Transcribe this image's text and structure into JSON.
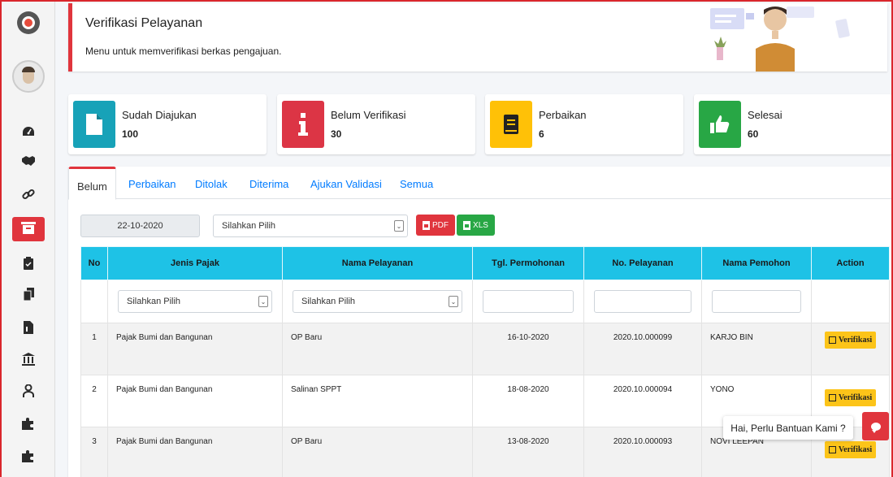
{
  "header": {
    "title": "Verifikasi Pelayanan",
    "subtitle": "Menu untuk memverifikasi berkas pengajuan."
  },
  "colors": {
    "accent": "#e0353d",
    "cyan": "#17a2b8",
    "red": "#dc3545",
    "yellow": "#ffc107",
    "green": "#28a745",
    "table_header": "#1ec2e6"
  },
  "sidebar": {
    "icons": [
      "logo-icon",
      "avatar",
      "dashboard-icon",
      "handshake-icon",
      "link-icon",
      "archive-icon",
      "clipboard-icon",
      "copy-icon",
      "file-icon",
      "bank-icon",
      "user-tie-icon",
      "puzzle-icon",
      "puzzle-icon"
    ]
  },
  "stats": [
    {
      "label": "Sudah Diajukan",
      "value": "100",
      "icon": "file-icon"
    },
    {
      "label": "Belum Verifikasi",
      "value": "30",
      "icon": "info-icon"
    },
    {
      "label": "Perbaikan",
      "value": "6",
      "icon": "book-icon"
    },
    {
      "label": "Selesai",
      "value": "60",
      "icon": "thumbs-up-icon"
    }
  ],
  "tabs": [
    "Belum",
    "Perbaikan",
    "Ditolak",
    "Diterima",
    "Ajukan Validasi",
    "Semua"
  ],
  "filters": {
    "date": "22-10-2020",
    "select": "Silahkan Pilih",
    "pdf": "PDF",
    "xls": "XLS"
  },
  "table": {
    "headers": [
      "No",
      "Jenis Pajak",
      "Nama Pelayanan",
      "Tgl. Permohonan",
      "No. Pelayanan",
      "Nama Pemohon",
      "Action"
    ],
    "filter_select": "Silahkan Pilih",
    "rows": [
      {
        "no": "1",
        "jenis": "Pajak Bumi dan Bangunan",
        "layanan": "OP Baru",
        "tgl": "16-10-2020",
        "nomor": "2020.10.000099",
        "pemohon": "KARJO BIN",
        "action": "Verifikasi"
      },
      {
        "no": "2",
        "jenis": "Pajak Bumi dan Bangunan",
        "layanan": "Salinan SPPT",
        "tgl": "18-08-2020",
        "nomor": "2020.10.000094",
        "pemohon": "YONO",
        "action": "Verifikasi"
      },
      {
        "no": "3",
        "jenis": "Pajak Bumi dan Bangunan",
        "layanan": "OP Baru",
        "tgl": "13-08-2020",
        "nomor": "2020.10.000093",
        "pemohon": "NOVI LEEPAN",
        "action": "Verifikasi"
      }
    ]
  },
  "chat": {
    "text": "Hai, Perlu Bantuan Kami ?"
  }
}
